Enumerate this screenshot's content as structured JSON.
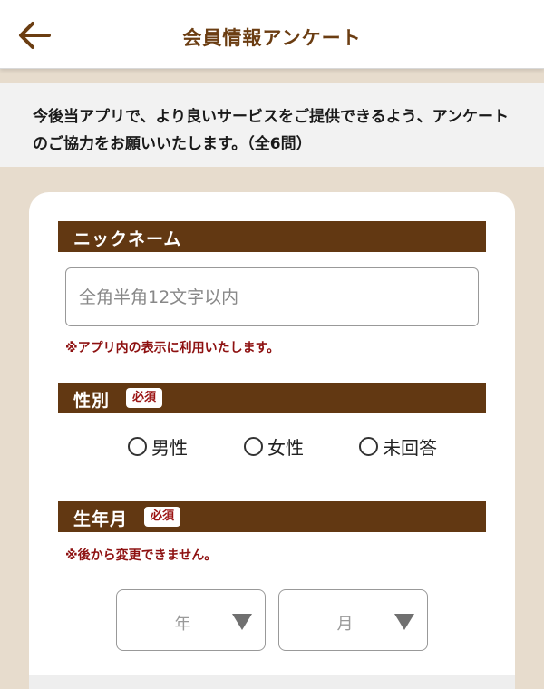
{
  "header": {
    "title": "会員情報アンケート",
    "back_icon": "arrow-left-icon"
  },
  "intro": {
    "text": "今後当アプリで、より良いサービスをご提供できるよう、アンケートのご協力をお願いいたします。（全6問）"
  },
  "form": {
    "nickname": {
      "label": "ニックネーム",
      "placeholder": "全角半角12文字以内",
      "value": "",
      "note": "※アプリ内の表示に利用いたします。"
    },
    "gender": {
      "label": "性別",
      "required": "必須",
      "options": [
        "男性",
        "女性",
        "未回答"
      ],
      "selected": null
    },
    "birth": {
      "label": "生年月",
      "required": "必須",
      "note": "※後から変更できません。",
      "year_placeholder": "年",
      "month_placeholder": "月"
    }
  },
  "colors": {
    "brand": "#623812",
    "required_text": "#9a1212",
    "background": "#e7dccd"
  }
}
